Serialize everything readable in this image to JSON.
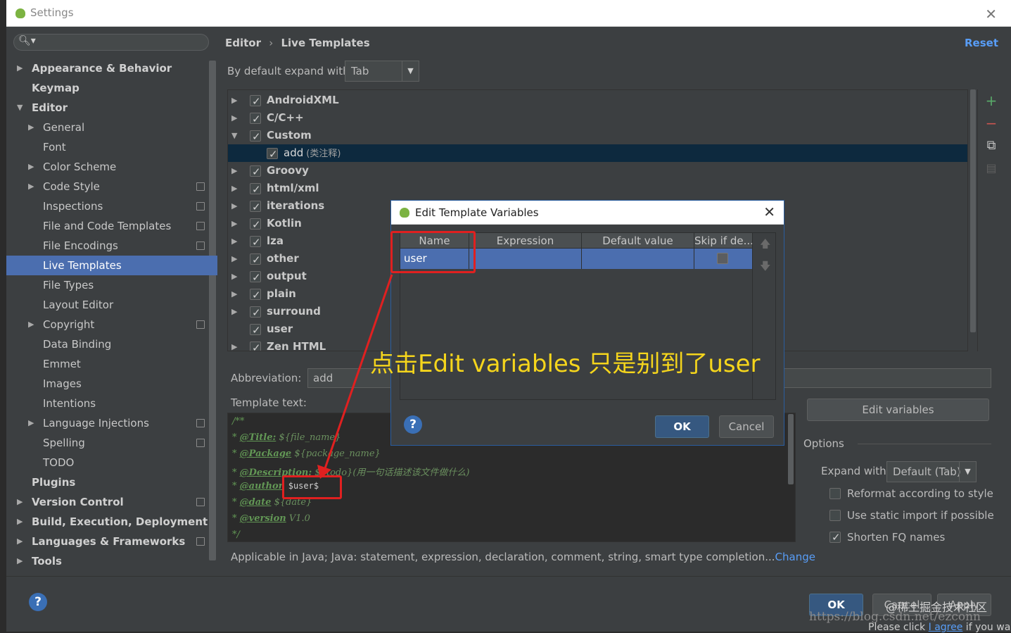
{
  "window": {
    "title": "Settings"
  },
  "search": {
    "placeholder": ""
  },
  "sidebar": {
    "items": [
      {
        "label": "Appearance & Behavior"
      },
      {
        "label": "Keymap"
      },
      {
        "label": "Editor"
      },
      {
        "label": "General"
      },
      {
        "label": "Font"
      },
      {
        "label": "Color Scheme"
      },
      {
        "label": "Code Style"
      },
      {
        "label": "Inspections"
      },
      {
        "label": "File and Code Templates"
      },
      {
        "label": "File Encodings"
      },
      {
        "label": "Live Templates"
      },
      {
        "label": "File Types"
      },
      {
        "label": "Layout Editor"
      },
      {
        "label": "Copyright"
      },
      {
        "label": "Data Binding"
      },
      {
        "label": "Emmet"
      },
      {
        "label": "Images"
      },
      {
        "label": "Intentions"
      },
      {
        "label": "Language Injections"
      },
      {
        "label": "Spelling"
      },
      {
        "label": "TODO"
      },
      {
        "label": "Plugins"
      },
      {
        "label": "Version Control"
      },
      {
        "label": "Build, Execution, Deployment"
      },
      {
        "label": "Languages & Frameworks"
      },
      {
        "label": "Tools"
      }
    ],
    "selected": "Live Templates"
  },
  "header": {
    "breadcrumb": [
      "Editor",
      "Live Templates"
    ],
    "separator": "›",
    "reset_label": "Reset"
  },
  "expand_default": {
    "label": "By default expand with",
    "value": "Tab"
  },
  "template_groups": [
    {
      "label": "AndroidXML"
    },
    {
      "label": "C/C++"
    },
    {
      "label": "Custom"
    },
    {
      "label": "add",
      "desc": "(类注释)"
    },
    {
      "label": "Groovy"
    },
    {
      "label": "html/xml"
    },
    {
      "label": "iterations"
    },
    {
      "label": "Kotlin"
    },
    {
      "label": "lza"
    },
    {
      "label": "other"
    },
    {
      "label": "output"
    },
    {
      "label": "plain"
    },
    {
      "label": "surround"
    },
    {
      "label": "user"
    },
    {
      "label": "Zen HTML"
    }
  ],
  "list_toolbar": {
    "add": "+",
    "remove": "−",
    "copy": "⧉",
    "change": "▤"
  },
  "abbreviation": {
    "label": "Abbreviation:",
    "value": "add"
  },
  "template_text": {
    "label": "Template text:",
    "lines": [
      {
        "pre": "/**",
        "tag": "",
        "val": ""
      },
      {
        "pre": "* ",
        "tag": "@Title:",
        "val": " ${file_name}"
      },
      {
        "pre": "* ",
        "tag": "@Package",
        "val": " ${package_name}"
      },
      {
        "pre": "* ",
        "tag": "@Description:",
        "val": " ${todo}(用一句话描述该文件做什么)"
      },
      {
        "pre": "* ",
        "tag": "@author",
        "val": " $user$"
      },
      {
        "pre": "* ",
        "tag": "@date",
        "val": " ${date}"
      },
      {
        "pre": "* ",
        "tag": "@version",
        "val": " V1.0"
      },
      {
        "pre": "*/",
        "tag": "",
        "val": ""
      }
    ]
  },
  "edit_variables_label": "Edit variables",
  "options": {
    "label": "Options",
    "expand_label": "Expand with",
    "expand_value": "Default (Tab)",
    "checks": [
      {
        "label": "Reformat according to style",
        "checked": false
      },
      {
        "label": "Use static import if possible",
        "checked": false
      },
      {
        "label": "Shorten FQ names",
        "checked": true
      }
    ]
  },
  "applicable": {
    "text": "Applicable in Java; Java: statement, expression, declaration, comment, string, smart type completion...",
    "link": "Change"
  },
  "bottom": {
    "ok_label": "OK",
    "cancel_label": "Cancel",
    "apply_label": "Apply",
    "help": "?"
  },
  "watermark": {
    "text": "https://blog.csdn.net/ezconn",
    "overlay": "@稀土掘金技术社区"
  },
  "below_text": {
    "pre": "Please click ",
    "link": "I agree",
    "post": " if you wan"
  },
  "dialog": {
    "title": "Edit Template Variables",
    "columns": [
      "Name",
      "Expression",
      "Default value",
      "Skip if de..."
    ],
    "rows": [
      {
        "name": "user",
        "expression": "",
        "default_value": "",
        "skip": false
      }
    ],
    "ok_label": "OK",
    "cancel_label": "Cancel",
    "help": "?"
  },
  "annotation": {
    "text": "点击Edit variables  只是别到了user",
    "color": "#f5d51c",
    "box_color": "#e02020"
  }
}
